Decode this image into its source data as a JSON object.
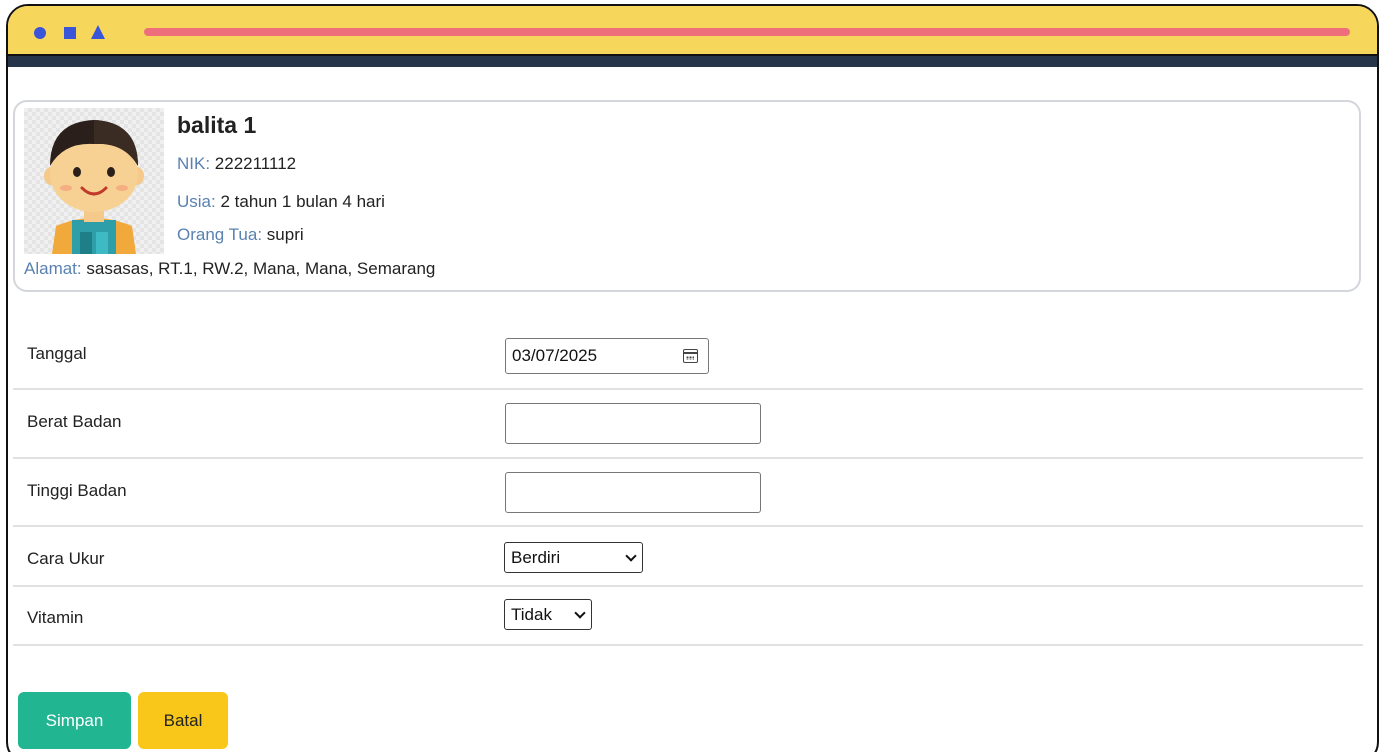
{
  "window": {
    "accent_color": "#f7d65c",
    "bar_color": "#ee6f7b",
    "shape_color": "#3b55d9",
    "shapes": [
      "circle",
      "square",
      "triangle"
    ]
  },
  "profile": {
    "avatar_icon": "boy-avatar",
    "name": "balita 1",
    "nik_label": "NIK:",
    "nik_value": "222211112",
    "age_label": "Usia:",
    "age_value": "2 tahun 1 bulan 4 hari",
    "parent_label": "Orang Tua:",
    "parent_value": "supri",
    "address_label": "Alamat:",
    "address_value": "sasasas, RT.1, RW.2, Mana, Mana, Semarang"
  },
  "form": {
    "date_label": "Tanggal",
    "date_value": "03/07/2025",
    "weight_label": "Berat Badan",
    "weight_value": "",
    "height_label": "Tinggi Badan",
    "height_value": "",
    "method_label": "Cara Ukur",
    "method_value": "Berdiri",
    "vitamin_label": "Vitamin",
    "vitamin_value": "Tidak"
  },
  "actions": {
    "save_label": "Simpan",
    "save_color": "#21b592",
    "cancel_label": "Batal",
    "cancel_color": "#f8c71a"
  }
}
